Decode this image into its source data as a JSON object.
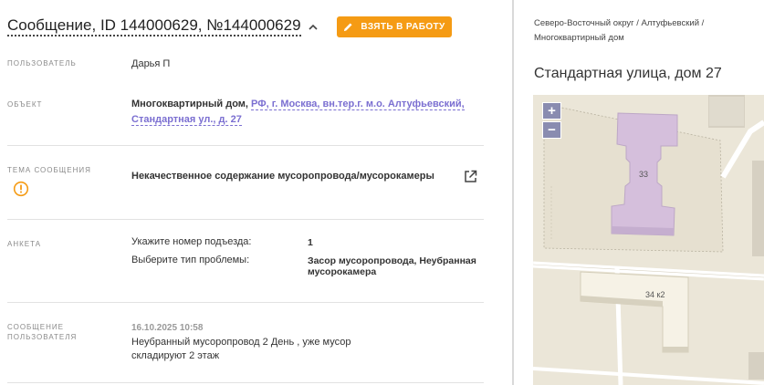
{
  "header": {
    "title": "Сообщение, ID 144000629, №144000629",
    "take_button_label": "ВЗЯТЬ В РАБОТУ"
  },
  "fields": {
    "user_label": "ПОЛЬЗОВАТЕЛЬ",
    "user_value": "Дарья П",
    "object_label": "ОБЪЕКТ",
    "object_type": "Многоквартирный дом,",
    "object_link_line1": "РФ, г. Москва, вн.тер.г. м.о. Алтуфьевский,",
    "object_link_line2": "Стандартная ул., д. 27",
    "topic_label": "ТЕМА СООБЩЕНИЯ",
    "topic_value": "Некачественное содержание мусоропровода/мусорокамеры",
    "survey_label": "АНКЕТА",
    "survey": [
      {
        "question": "Укажите номер подъезда:",
        "answer": "1"
      },
      {
        "question": "Выберите тип проблемы:",
        "answer": "Засор мусоропровода, Неубранная мусорокамера"
      }
    ],
    "message_label_line1": "СООБЩЕНИЕ",
    "message_label_line2": "ПОЛЬЗОВАТЕЛЯ",
    "message_date": "16.10.2025 10:58",
    "message_text": "Неубранный мусоропровод 2 День , уже мусор складируют 2 этаж"
  },
  "side": {
    "breadcrumb": "Северо-Восточный округ / Алтуфьевский / Многоквартирный дом",
    "address": "Стандартная улица, дом 27"
  },
  "map": {
    "zoom_in": "+",
    "zoom_out": "−",
    "building_label_main": "33",
    "building_label_other": "34 к2"
  },
  "colors": {
    "accent_button": "#f59b14",
    "link": "#7b6fd1",
    "highlight_building": "#dcc8e3",
    "warning": "#f59b14"
  }
}
